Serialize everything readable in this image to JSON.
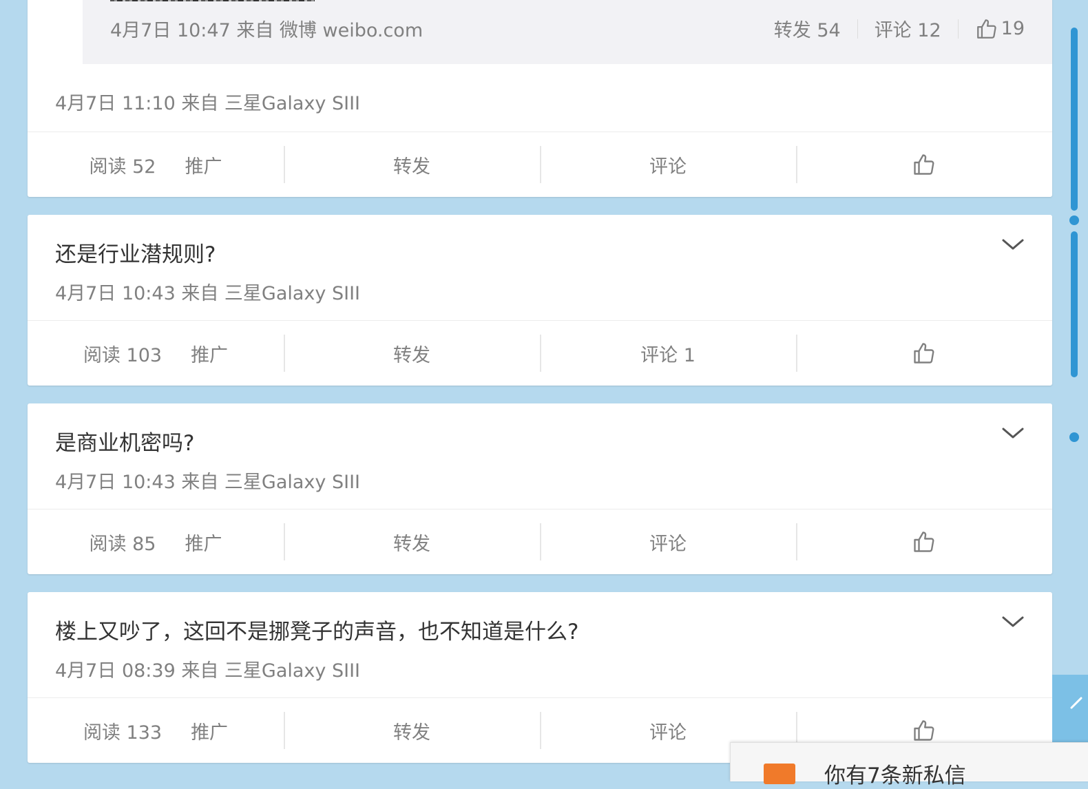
{
  "quoted_post": {
    "meta": "4月7日 10:47 来自 微博 weibo.com",
    "repost": "转发 54",
    "comment": "评论 12",
    "likes": "19"
  },
  "posts": [
    {
      "meta": "4月7日 11:10 来自 三星Galaxy SIII",
      "read": "阅读 52",
      "promote": "推广",
      "repost": "转发",
      "comment": "评论"
    },
    {
      "title": "还是行业潜规则?",
      "meta": "4月7日 10:43 来自 三星Galaxy SIII",
      "read": "阅读 103",
      "promote": "推广",
      "repost": "转发",
      "comment": "评论 1"
    },
    {
      "title": "是商业机密吗?",
      "meta": "4月7日 10:43 来自 三星Galaxy SIII",
      "read": "阅读 85",
      "promote": "推广",
      "repost": "转发",
      "comment": "评论"
    },
    {
      "title": "楼上又吵了，这回不是挪凳子的声音，也不知道是什么?",
      "meta": "4月7日 08:39 来自 三星Galaxy SIII",
      "read": "阅读 133",
      "promote": "推广",
      "repost": "转发",
      "comment": "评论"
    }
  ],
  "popup": {
    "text": "你有7条新私信"
  },
  "colors": {
    "background": "#b5d9ee",
    "accent": "#2f95d3",
    "mail": "#f07a2a"
  },
  "icons": [
    "thumbs-up-icon",
    "chevron-down-icon",
    "mail-icon",
    "back-to-top-icon"
  ]
}
